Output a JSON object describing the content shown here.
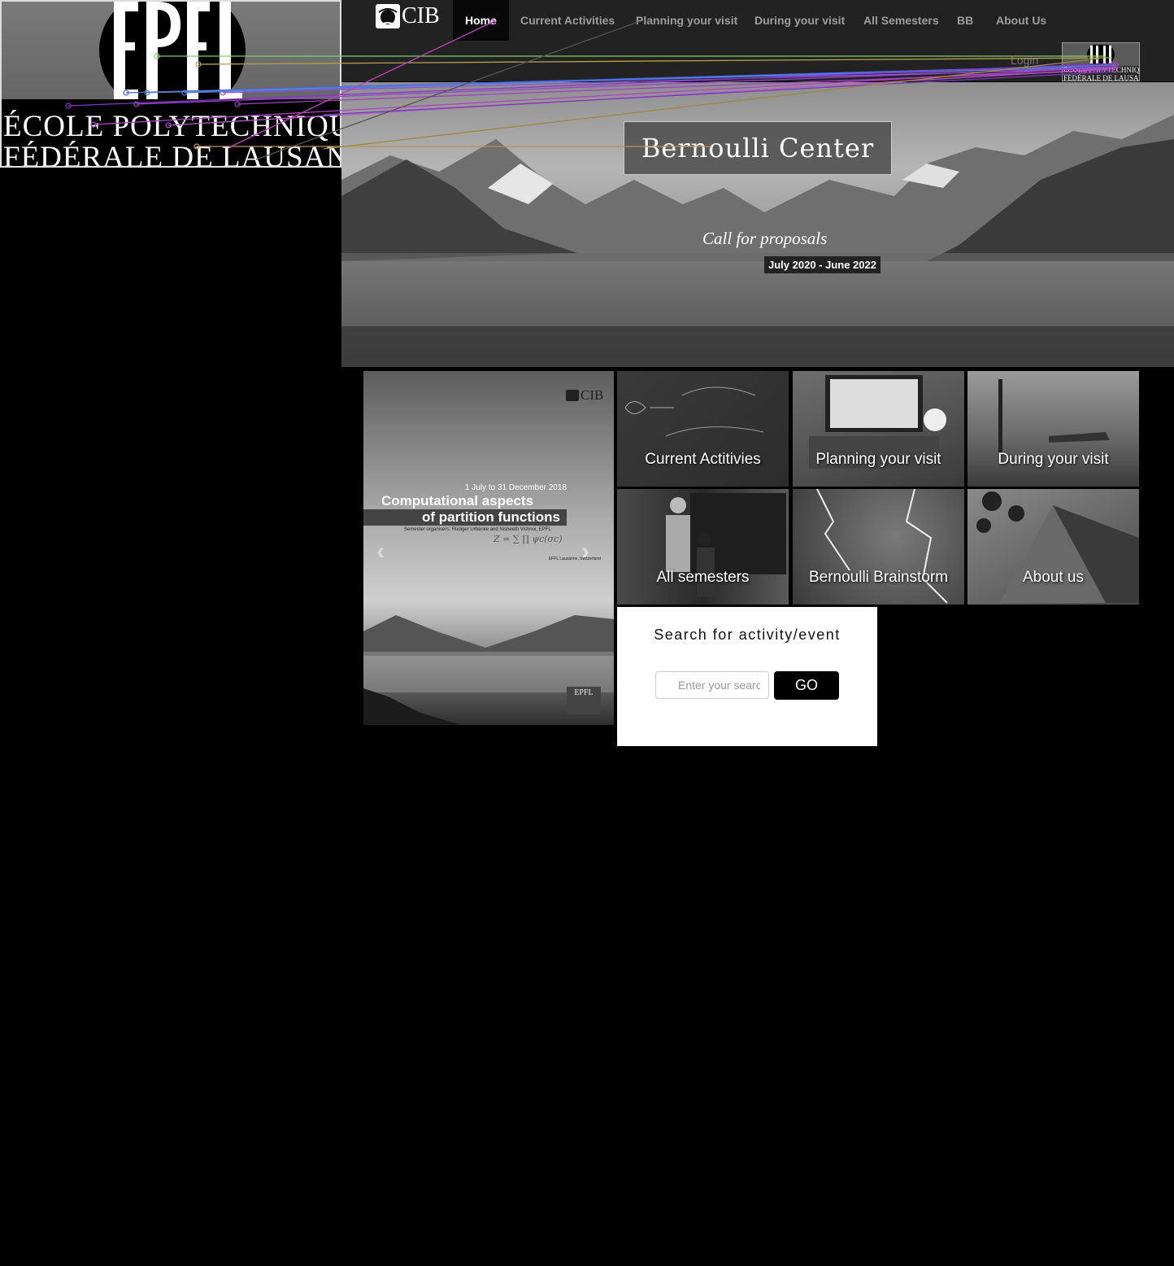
{
  "epfl_logo": {
    "mark_text": "EPFL",
    "line1": "ÉCOLE POLYTECHNIQUE",
    "line2": "FÉDÉRALE DE LAUSANNE"
  },
  "navbar": {
    "brand": "CIB",
    "items": [
      {
        "label": "Home",
        "active": true
      },
      {
        "label": "Current Activities"
      },
      {
        "label": "Planning your visit"
      },
      {
        "label": "During your visit"
      },
      {
        "label": "All Semesters"
      },
      {
        "label": "BB"
      },
      {
        "label": "About Us"
      }
    ],
    "login": "Login",
    "mini_logo": {
      "line1": "ÉCOLE POLYTECHNIQUE",
      "line2": "FÉDÉRALE DE LAUSANNE"
    }
  },
  "hero": {
    "title": "Bernoulli Center",
    "subtitle": "Call for proposals",
    "date": "July 2020 - June 2022"
  },
  "carousel": {
    "brand": "CIB",
    "date": "1 July to 31 December 2018",
    "title_line1": "Computational aspects",
    "title_line2": "of partition functions",
    "organisers": "Semester organisers: Rüdiger Urbanke and Nisheeth Vishnoi, EPFL",
    "formula": "Z = ∑ ∏ ψc(σc)",
    "location": "EPFL Lausanne, Switzerland",
    "prev_glyph": "‹",
    "next_glyph": "›",
    "footer_logo": "EPFL"
  },
  "tiles": [
    {
      "label": "Current Actitivies"
    },
    {
      "label": "Planning your visit"
    },
    {
      "label": "During your visit"
    },
    {
      "label": "All semesters"
    },
    {
      "label": "Bernoulli Brainstorm"
    },
    {
      "label": "About us"
    }
  ],
  "search": {
    "title": "Search for activity/event",
    "placeholder": "Enter your search",
    "button": "GO"
  },
  "colors": {
    "navbar_bg": "#222222",
    "nav_active_bg": "#080808",
    "nav_text": "#9d9d9d",
    "page_bg": "#000000"
  }
}
